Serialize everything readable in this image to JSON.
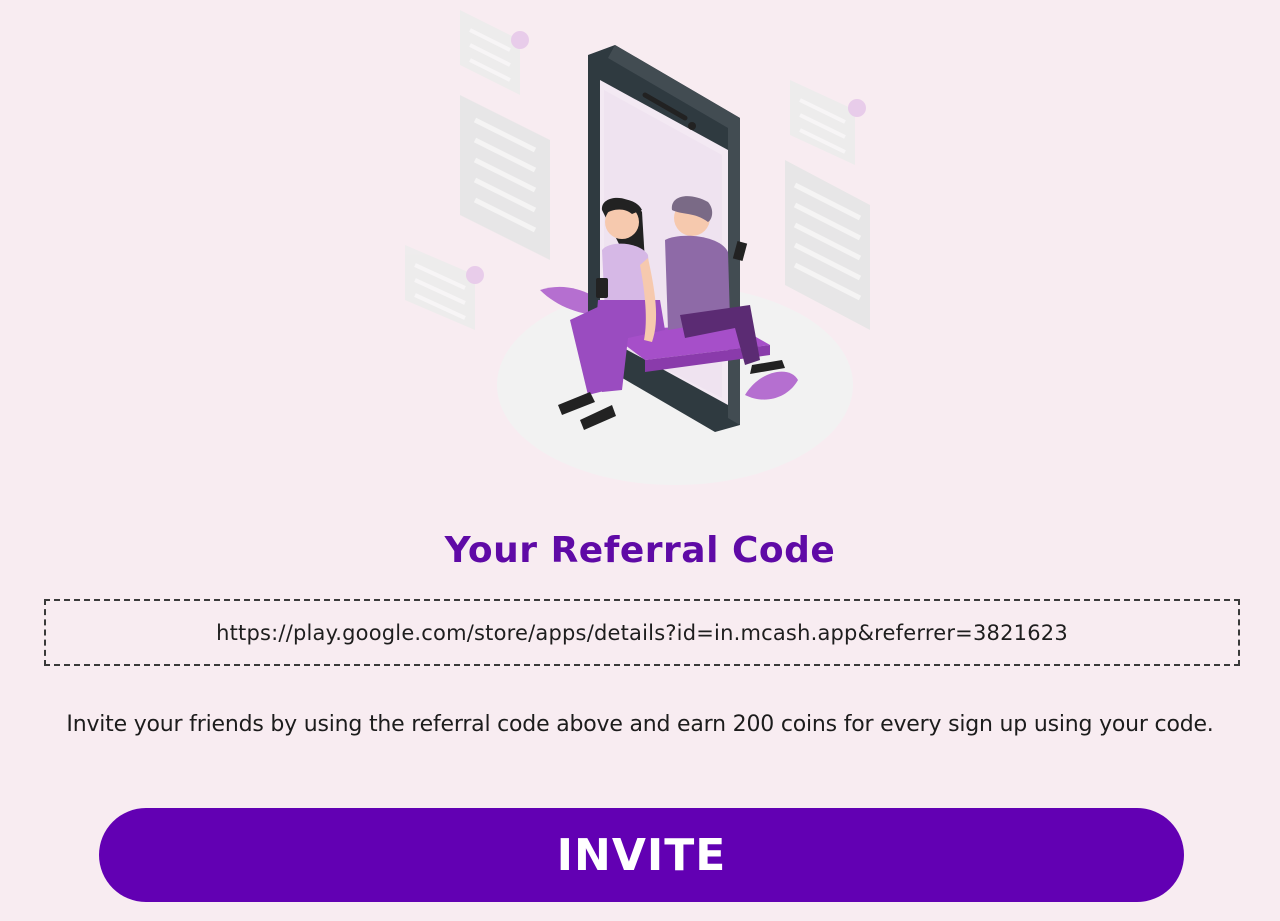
{
  "referral": {
    "title": "Your Referral Code",
    "link": "https://play.google.com/store/apps/details?id=in.mcash.app&referrer=3821623",
    "description": "Invite your friends by using the referral code above and earn 200 coins for every sign up using your code.",
    "invite_label": "INVITE"
  },
  "illustration": {
    "icon": "referral-illustration"
  },
  "colors": {
    "background": "#f8ecf1",
    "accent": "#6200b3",
    "title": "#5f0aa6"
  }
}
